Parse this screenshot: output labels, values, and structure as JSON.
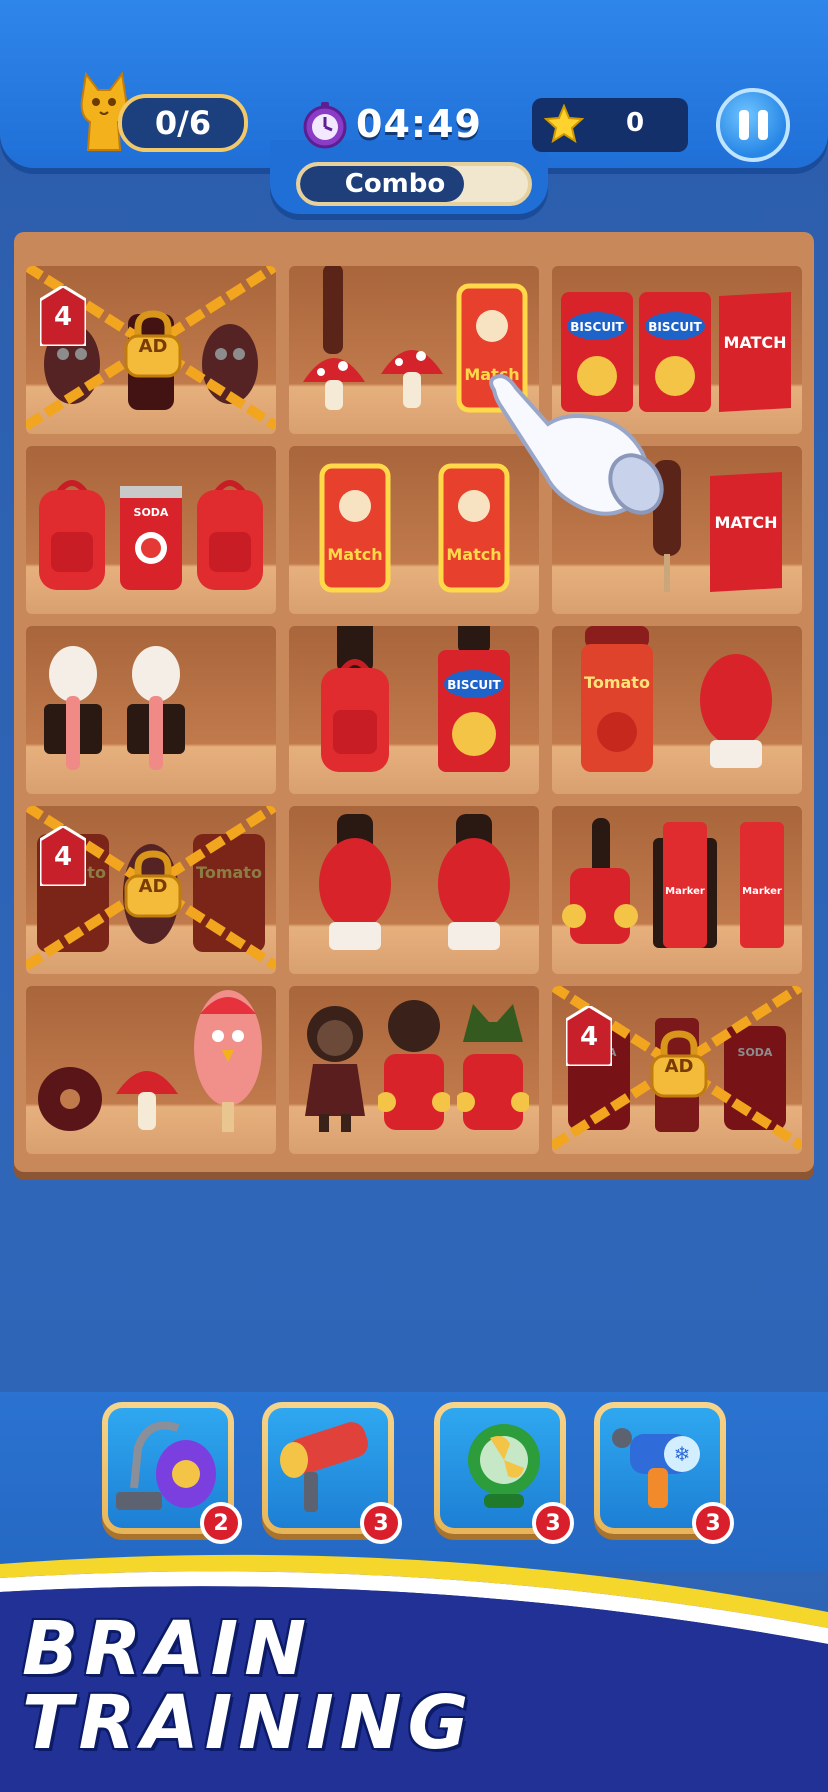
{
  "hud": {
    "collected": "0/6",
    "timer": "04:49",
    "score": "0",
    "combo_label": "Combo",
    "combo_fill": 0.72
  },
  "shelves": {
    "locked_count_label": "4",
    "ad_label": "AD",
    "labels": {
      "biscuit": "BISCUIT",
      "match": "MATCH",
      "soda": "SODA",
      "tomato": "Tomato",
      "marker": "Marker",
      "match_can": "Match"
    }
  },
  "tools": [
    {
      "name": "vacuum",
      "count": "2"
    },
    {
      "name": "paint-roller",
      "count": "3"
    },
    {
      "name": "fan",
      "count": "3"
    },
    {
      "name": "freeze-gun",
      "count": "3"
    }
  ],
  "banner": {
    "line1": "BRAIN",
    "line2": "TRAINING"
  },
  "colors": {
    "accent": "#2f86ea",
    "gold": "#f1c86a",
    "badge_red": "#d91f2c"
  }
}
